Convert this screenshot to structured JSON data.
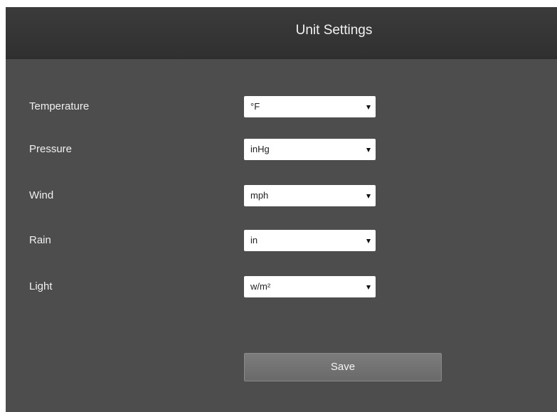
{
  "header": {
    "title": "Unit Settings"
  },
  "settings": [
    {
      "label": "Temperature",
      "value": "°F"
    },
    {
      "label": "Pressure",
      "value": "inHg"
    },
    {
      "label": "Wind",
      "value": "mph"
    },
    {
      "label": "Rain",
      "value": "in"
    },
    {
      "label": "Light",
      "value": "w/m²"
    }
  ],
  "actions": {
    "save_label": "Save"
  },
  "colors": {
    "panel_bg": "#4d4d4d",
    "header_bg": "#333333",
    "button_bg": "#737373"
  }
}
